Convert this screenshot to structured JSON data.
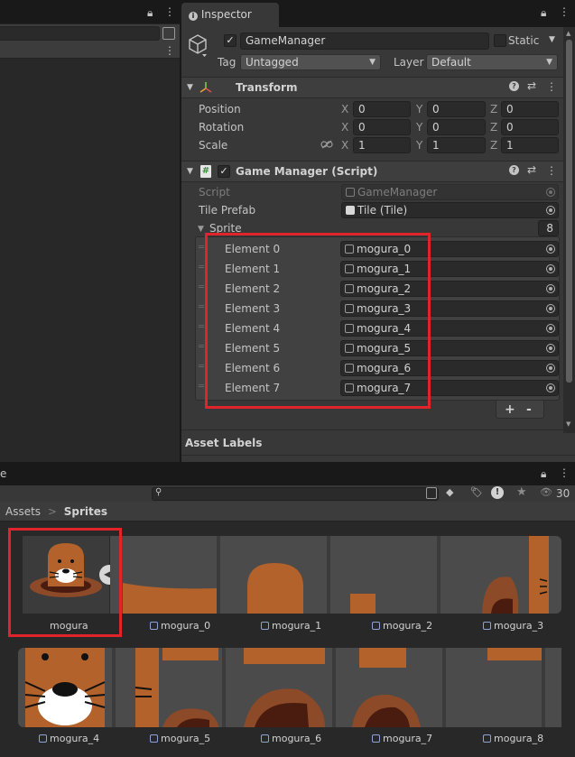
{
  "inspector": {
    "tab_title": "Inspector",
    "object_name": "GameManager",
    "static_label": "Static",
    "tag_label": "Tag",
    "tag_value": "Untagged",
    "layer_label": "Layer",
    "layer_value": "Default"
  },
  "transform": {
    "title": "Transform",
    "rows": [
      {
        "label": "Position",
        "x": "0",
        "y": "0",
        "z": "0"
      },
      {
        "label": "Rotation",
        "x": "0",
        "y": "0",
        "z": "0"
      },
      {
        "label": "Scale",
        "x": "1",
        "y": "1",
        "z": "1"
      }
    ],
    "axis_labels": [
      "X",
      "Y",
      "Z"
    ]
  },
  "script_component": {
    "title": "Game Manager (Script)",
    "script_label": "Script",
    "script_value": "GameManager",
    "tile_prefab_label": "Tile Prefab",
    "tile_prefab_value": "Tile (Tile)",
    "sprite_label": "Sprite",
    "sprite_count": "8",
    "elements": [
      {
        "label": "Element 0",
        "value": "mogura_0"
      },
      {
        "label": "Element 1",
        "value": "mogura_1"
      },
      {
        "label": "Element 2",
        "value": "mogura_2"
      },
      {
        "label": "Element 3",
        "value": "mogura_3"
      },
      {
        "label": "Element 4",
        "value": "mogura_4"
      },
      {
        "label": "Element 5",
        "value": "mogura_5"
      },
      {
        "label": "Element 6",
        "value": "mogura_6"
      },
      {
        "label": "Element 7",
        "value": "mogura_7"
      }
    ],
    "add_label": "+",
    "remove_label": "-"
  },
  "asset_labels": "Asset Labels",
  "project": {
    "tab_fragment": "e",
    "visible_count": "30",
    "breadcrumb_root": "Assets",
    "breadcrumb_separator": ">",
    "breadcrumb_current": "Sprites",
    "row1": [
      "mogura",
      "mogura_0",
      "mogura_1",
      "mogura_2",
      "mogura_3"
    ],
    "row2": [
      "mogura_4",
      "mogura_5",
      "mogura_6",
      "mogura_7",
      "mogura_8"
    ]
  },
  "colors": {
    "highlight": "#e1242a",
    "mole_body": "#b2622a",
    "mole_hole": "#4a1c10",
    "mole_dirt": "#8c4a28"
  }
}
